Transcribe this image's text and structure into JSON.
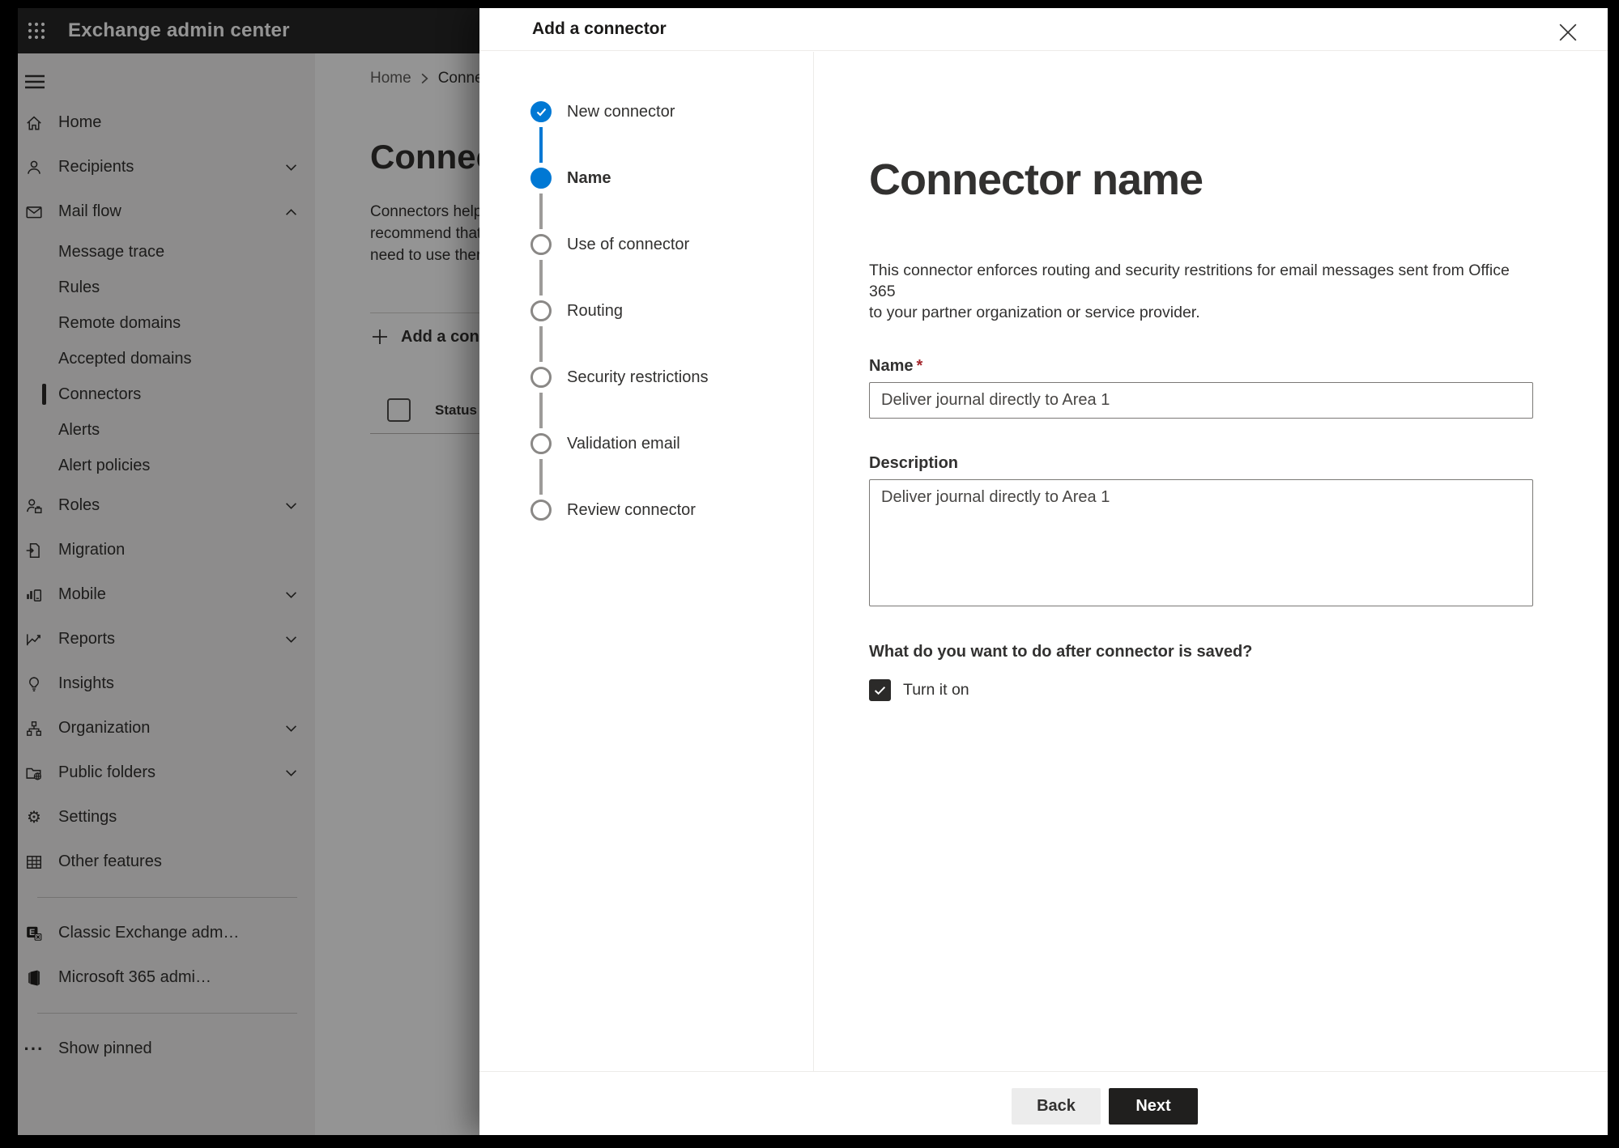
{
  "app": {
    "title": "Exchange admin center"
  },
  "sidebar": {
    "items": [
      {
        "label": "Home",
        "icon": "home-icon"
      },
      {
        "label": "Recipients",
        "icon": "person-icon",
        "chevron": "down"
      },
      {
        "label": "Mail flow",
        "icon": "mail-icon",
        "chevron": "up",
        "expanded": true
      },
      {
        "label": "Message trace",
        "sub": true
      },
      {
        "label": "Rules",
        "sub": true
      },
      {
        "label": "Remote domains",
        "sub": true
      },
      {
        "label": "Accepted domains",
        "sub": true
      },
      {
        "label": "Connectors",
        "sub": true,
        "selected": true
      },
      {
        "label": "Alerts",
        "sub": true
      },
      {
        "label": "Alert policies",
        "sub": true
      },
      {
        "label": "Roles",
        "icon": "roles-icon",
        "chevron": "down"
      },
      {
        "label": "Migration",
        "icon": "migration-icon"
      },
      {
        "label": "Mobile",
        "icon": "mobile-icon",
        "chevron": "down"
      },
      {
        "label": "Reports",
        "icon": "reports-icon",
        "chevron": "down"
      },
      {
        "label": "Insights",
        "icon": "insights-icon"
      },
      {
        "label": "Organization",
        "icon": "organization-icon",
        "chevron": "down"
      },
      {
        "label": "Public folders",
        "icon": "public-folders-icon",
        "chevron": "down"
      },
      {
        "label": "Settings",
        "icon": "settings-icon"
      },
      {
        "label": "Other features",
        "icon": "other-features-icon"
      },
      {
        "label": "Classic Exchange adm…",
        "icon": "exchange-icon"
      },
      {
        "label": "Microsoft 365 admi…",
        "icon": "office-icon"
      },
      {
        "label": "Show pinned",
        "icon": "more-icon"
      }
    ]
  },
  "page": {
    "breadcrumb": {
      "home": "Home",
      "current": "Conne"
    },
    "title": "Connect",
    "intro": {
      "line1": "Connectors help",
      "line2": "recommend that",
      "line3": "need to use ther"
    },
    "add_button_label": "Add a conn",
    "table": {
      "status_header": "Status"
    }
  },
  "dialog": {
    "title": "Add a connector",
    "steps": [
      {
        "label": "New connector",
        "state": "completed"
      },
      {
        "label": "Name",
        "state": "active"
      },
      {
        "label": "Use of connector",
        "state": "upcoming"
      },
      {
        "label": "Routing",
        "state": "upcoming"
      },
      {
        "label": "Security restrictions",
        "state": "upcoming"
      },
      {
        "label": "Validation email",
        "state": "upcoming"
      },
      {
        "label": "Review connector",
        "state": "upcoming"
      }
    ],
    "content": {
      "heading": "Connector name",
      "desc_line1": "This connector enforces routing and security restritions for email messages sent from Office 365",
      "desc_line2": "to your partner organization or service provider.",
      "name_label": "Name",
      "required_marker": "*",
      "name_value": "Deliver journal directly to Area 1",
      "description_label": "Description",
      "description_value": "Deliver journal directly to Area 1",
      "after_save_question": "What do you want to do after connector is saved?",
      "turn_on_label": "Turn it on",
      "turn_on_checked": true
    },
    "footer": {
      "back": "Back",
      "next": "Next"
    }
  },
  "colors": {
    "accent": "#0078d4",
    "required": "#a4262c",
    "topbar": "#262626",
    "next_button": "#201f1e"
  }
}
